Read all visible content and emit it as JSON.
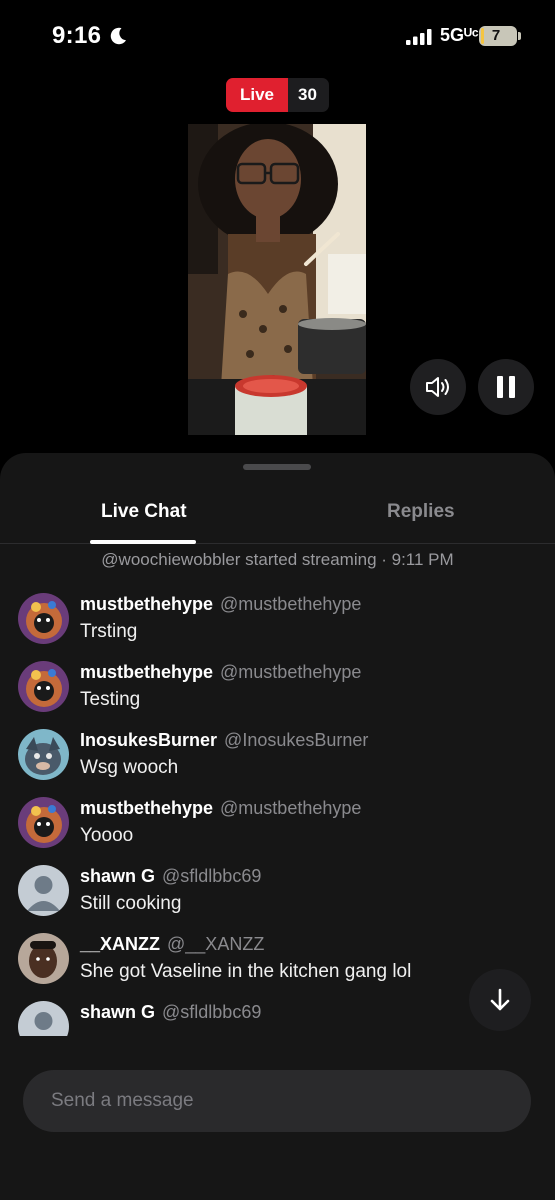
{
  "status_bar": {
    "time": "9:16",
    "network": "5Gᵁᶜ",
    "battery": "7",
    "battery_level_percent": 7,
    "icons": [
      "moon-icon",
      "signal-icon",
      "battery-icon"
    ]
  },
  "stream": {
    "live_label": "Live",
    "viewer_count": "30"
  },
  "controls": {
    "icons": [
      "speaker-icon",
      "pause-icon",
      "arrow-down-icon"
    ]
  },
  "tabs": [
    {
      "label": "Live Chat",
      "active": true
    },
    {
      "label": "Replies",
      "active": false
    }
  ],
  "system_message": "@woochiewobbler started streaming · 9:11 PM",
  "messages": [
    {
      "name": "mustbethehype",
      "handle": "@mustbethehype",
      "text": "Trsting",
      "avatar": "anime-avatar"
    },
    {
      "name": "mustbethehype",
      "handle": "@mustbethehype",
      "text": "Testing",
      "avatar": "anime-avatar"
    },
    {
      "name": "InosukesBurner",
      "handle": "@InosukesBurner",
      "text": "Wsg wooch",
      "avatar": "boar-mask-avatar"
    },
    {
      "name": "mustbethehype",
      "handle": "@mustbethehype",
      "text": "Yoooo",
      "avatar": "anime-avatar"
    },
    {
      "name": "shawn G",
      "handle": "@sfldlbbc69",
      "text": "Still cooking",
      "avatar": "default-avatar"
    },
    {
      "name": "__XANZZ",
      "handle": "@__XANZZ",
      "text": "She got Vaseline in the kitchen gang lol",
      "avatar": "photo-avatar"
    },
    {
      "name": "shawn G",
      "handle": "@sfldlbbc69",
      "text": "",
      "avatar": "default-avatar"
    }
  ],
  "composer": {
    "placeholder": "Send a message"
  },
  "colors": {
    "live_red": "#e0202f",
    "background": "#000000",
    "sheet": "#161616",
    "muted_text": "#8a8a8e"
  }
}
